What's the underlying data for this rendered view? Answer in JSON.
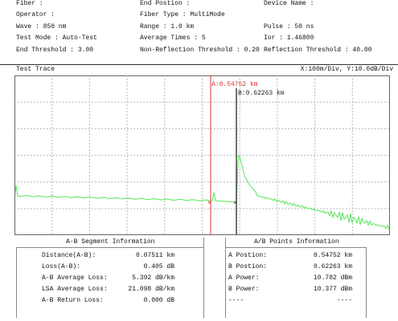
{
  "params": {
    "fiber_label": "Fiber :",
    "operator_label": "Operator :",
    "wave": "Wave : 850 nm",
    "test_mode": "Test Mode : Auto-Test",
    "end_threshold": "End Threshold : 3.00",
    "end_position_label": "End Postion :",
    "fiber_type": "Fiber Type : MultiMode",
    "range": "Range : 1.0 km",
    "average_times": "Average Times : 5",
    "non_reflection_threshold": "Non-Reflection Threshold : 0.20",
    "device_name_label": "Device Name :",
    "pulse": "Pulse : 50 ns",
    "ior": "Ior : 1.46800",
    "reflection_threshold": "Reflection Threshold : 40.00"
  },
  "trace": {
    "title": "Test Trace",
    "scale": "X:100m/Div, Y:10.0dB/Div",
    "marker_a_label": "A:0.54752 km",
    "marker_b_label": "B:0.62263 km",
    "marker_a_km": 0.54752,
    "marker_b_km": 0.62263,
    "colors": {
      "trace": "#55e655",
      "marker_a": "#e03030",
      "marker_b": "#444444",
      "grid": "#b8b8b8"
    }
  },
  "segment": {
    "title": "A-B Segment Information",
    "rows": [
      {
        "label": "Distance(A-B):",
        "value": "0.07511 km"
      },
      {
        "label": "Loss(A-B):",
        "value": "0.405 dB"
      },
      {
        "label": "A-B Average Loss:",
        "value": "5.392 dB/km"
      },
      {
        "label": "LSA Average Loss:",
        "value": "21.098 dB/km"
      },
      {
        "label": "A-B Return Loss:",
        "value": "0.000 dB"
      }
    ]
  },
  "points": {
    "title": "A/B Points Information",
    "rows": [
      {
        "label": "A Postion:",
        "value": "0.54752 km"
      },
      {
        "label": "B Postion:",
        "value": "0.62263 km"
      },
      {
        "label": "A Power:",
        "value": "10.782 dBm"
      },
      {
        "label": "B Power:",
        "value": "10.377 dBm"
      },
      {
        "label": "----",
        "value": "----"
      }
    ]
  }
}
